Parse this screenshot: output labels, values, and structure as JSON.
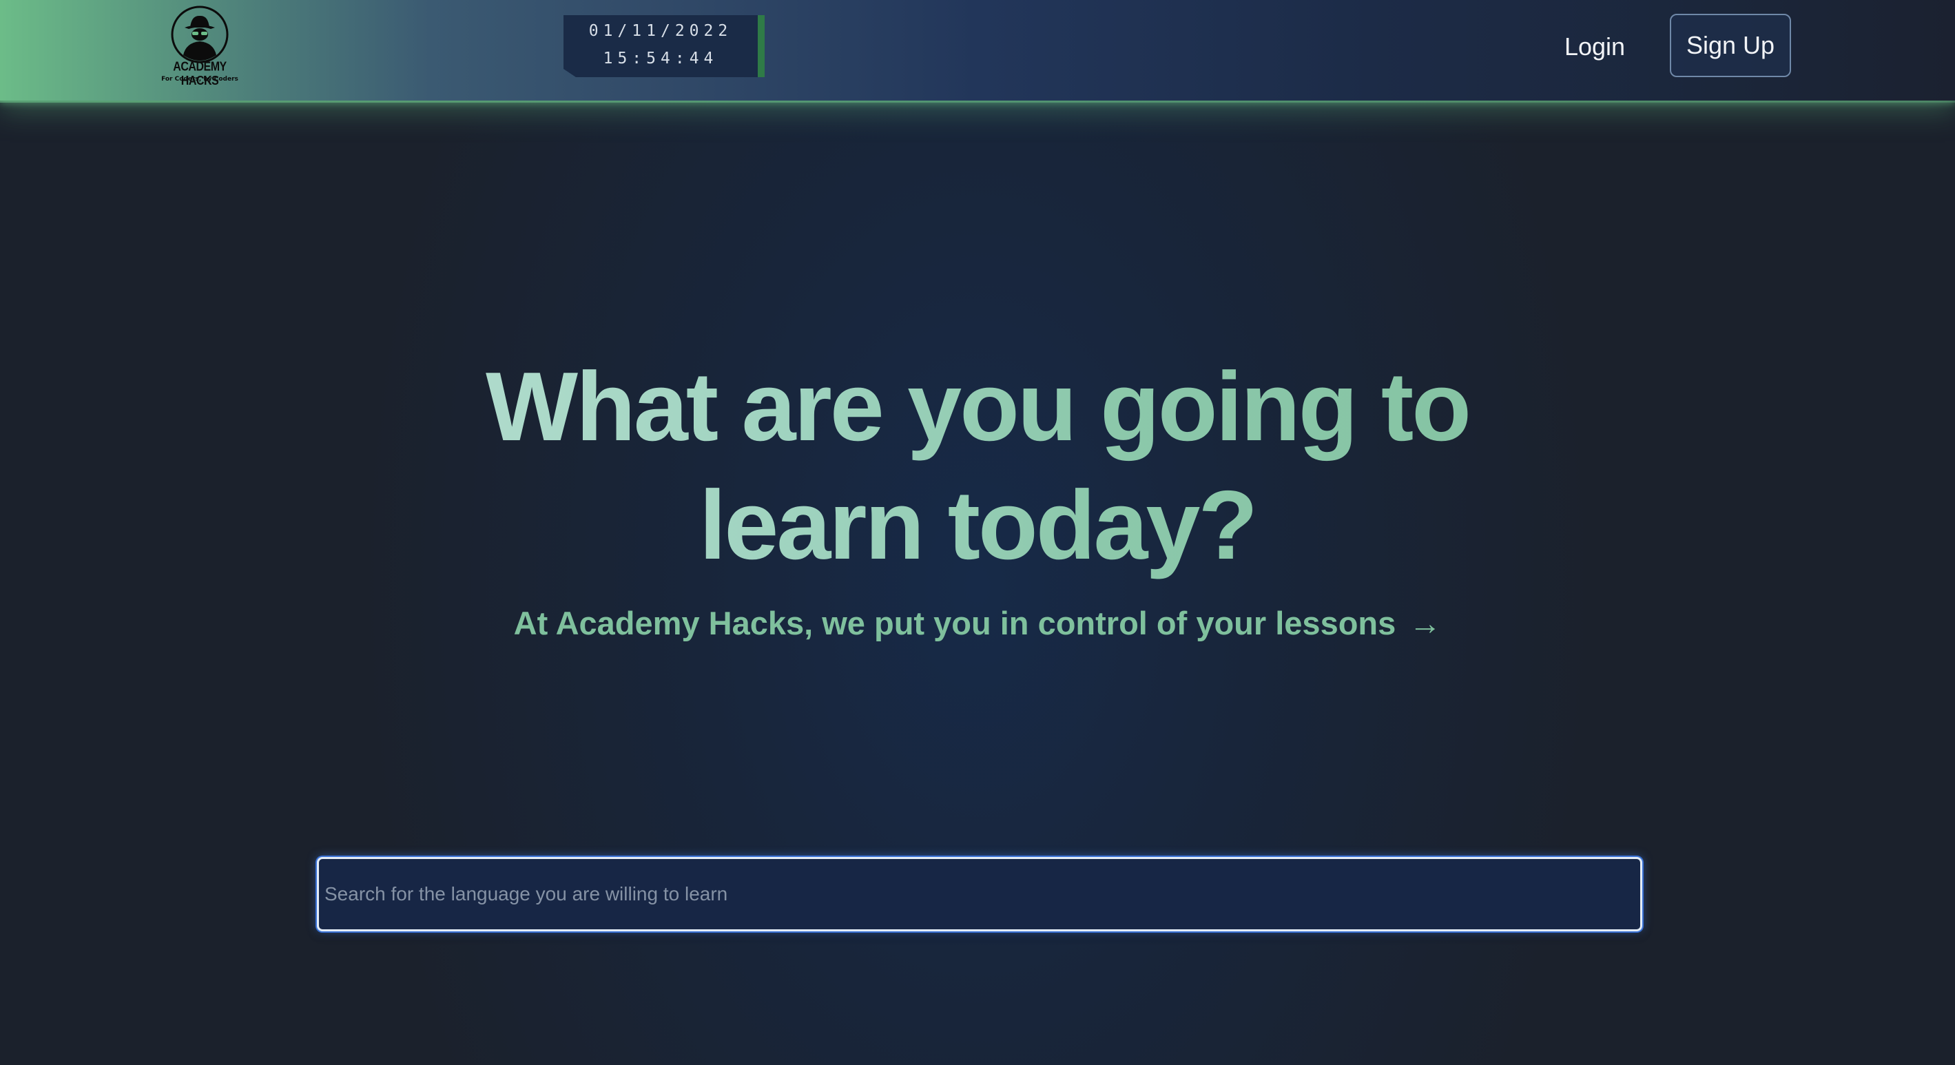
{
  "header": {
    "logo": {
      "icon": "spy-hat-icon",
      "title": "ACADEMY HACKS",
      "tagline": "For Coders, by Coders"
    },
    "clock": {
      "date": "01/11/2022",
      "time": "15:54:44"
    },
    "nav": {
      "login_label": "Login",
      "signup_label": "Sign Up"
    }
  },
  "hero": {
    "title_line1": "What are you going to",
    "title_line2": "learn today?",
    "subtitle": "At Academy Hacks, we put you in control of your lessons",
    "subtitle_arrow": "→"
  },
  "search": {
    "value": "",
    "placeholder": "Search for the language you are willing to learn"
  },
  "colors": {
    "accent_green": "#7fc09d",
    "header_start": "#6cbc88",
    "background": "#1b212c",
    "focus_ring": "#3a72d6"
  }
}
